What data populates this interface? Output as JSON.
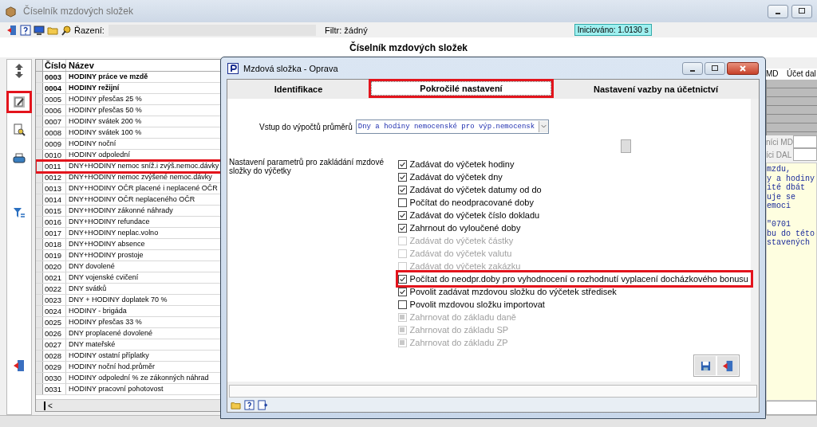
{
  "window": {
    "title": "Číselník mzdových složek"
  },
  "toolbar": {
    "sort_label": "Řazení:",
    "filter": "Filtr: žádný",
    "timer": "Iniciováno: 1.0130 s"
  },
  "heading": "Číselník mzdových složek",
  "side_tools": [
    {
      "kind": "up",
      "marked": false
    },
    {
      "kind": "down",
      "marked": false
    },
    {
      "kind": "edit",
      "marked": true
    },
    {
      "kind": "find",
      "marked": false
    },
    {
      "kind": "print",
      "marked": false
    },
    {
      "kind": "filter",
      "marked": false
    },
    {
      "kind": "exit",
      "marked": false
    }
  ],
  "table": {
    "columns": [
      "Číslo",
      "Název"
    ],
    "rows": [
      {
        "code": "0003",
        "name": "HODINY práce ve mzdě",
        "bold": true,
        "marked": false
      },
      {
        "code": "0004",
        "name": "HODINY režijní",
        "bold": true,
        "marked": false
      },
      {
        "code": "0005",
        "name": "HODINY přesčas 25 %",
        "bold": false,
        "marked": false
      },
      {
        "code": "0006",
        "name": "HODINY přesčas 50 %",
        "bold": false,
        "marked": false
      },
      {
        "code": "0007",
        "name": "HODINY svátek 200 %",
        "bold": false,
        "marked": false
      },
      {
        "code": "0008",
        "name": "HODINY svátek 100 %",
        "bold": false,
        "marked": false
      },
      {
        "code": "0009",
        "name": "HODINY noční",
        "bold": false,
        "marked": false
      },
      {
        "code": "0010",
        "name": "HODINY odpolední",
        "bold": false,
        "marked": false
      },
      {
        "code": "0011",
        "name": "DNY+HODINY nemoc sníž.i zvýš.nemoc.dávky",
        "bold": false,
        "marked": true
      },
      {
        "code": "0012",
        "name": "DNY+HODINY nemoc zvýšené nemoc.dávky",
        "bold": false,
        "marked": false
      },
      {
        "code": "0013",
        "name": "DNY+HODINY OČR placené i neplacené OČR",
        "bold": false,
        "marked": false
      },
      {
        "code": "0014",
        "name": "DNY+HODINY OČR neplaceného OČR",
        "bold": false,
        "marked": false
      },
      {
        "code": "0015",
        "name": "DNY+HODINY zákonné náhrady",
        "bold": false,
        "marked": false
      },
      {
        "code": "0016",
        "name": "DNY+HODINY refundace",
        "bold": false,
        "marked": false
      },
      {
        "code": "0017",
        "name": "DNY+HODINY neplac.volno",
        "bold": false,
        "marked": false
      },
      {
        "code": "0018",
        "name": "DNY+HODINY absence",
        "bold": false,
        "marked": false
      },
      {
        "code": "0019",
        "name": "DNY+HODINY prostoje",
        "bold": false,
        "marked": false
      },
      {
        "code": "0020",
        "name": "DNY dovolené",
        "bold": false,
        "marked": false
      },
      {
        "code": "0021",
        "name": "DNY vojenské cvičení",
        "bold": false,
        "marked": false
      },
      {
        "code": "0022",
        "name": "DNY svátků",
        "bold": false,
        "marked": false
      },
      {
        "code": "0023",
        "name": "DNY + HODINY doplatek 70 %",
        "bold": false,
        "marked": false
      },
      {
        "code": "0024",
        "name": "HODINY - brigáda",
        "bold": false,
        "marked": false
      },
      {
        "code": "0025",
        "name": "HODINY přesčas 33 %",
        "bold": false,
        "marked": false
      },
      {
        "code": "0026",
        "name": "DNY proplacené dovolené",
        "bold": false,
        "marked": false
      },
      {
        "code": "0027",
        "name": "DNY mateřské",
        "bold": false,
        "marked": false
      },
      {
        "code": "0028",
        "name": "HODINY ostatní příplatky",
        "bold": false,
        "marked": false
      },
      {
        "code": "0029",
        "name": "HODINY noční hod.průměr",
        "bold": false,
        "marked": false
      },
      {
        "code": "0030",
        "name": "HODINY odpolední % ze zákonných náhrad",
        "bold": false,
        "marked": false
      },
      {
        "code": "0031",
        "name": "HODINY pracovní pohotovost",
        "bold": false,
        "marked": false
      }
    ],
    "scroll_arrow": "<"
  },
  "side_panel": {
    "columns": [
      "MD",
      "Účet dal"
    ],
    "labels": [
      "níci MD",
      "íci DAL"
    ],
    "note_paragraphs": [
      [
        "mzdu,",
        "y a hodiny",
        "ité dbát",
        "uje se",
        "emoci"
      ],
      [
        "\"0701",
        "bu do této",
        "stavených"
      ]
    ]
  },
  "dialog": {
    "title": "Mzdová složka - Oprava",
    "tabs": [
      {
        "label": "Identifikace",
        "selected": false,
        "marked": false
      },
      {
        "label": "Pokročilé nastavení",
        "selected": true,
        "marked": true
      },
      {
        "label": "Nastavení vazby na účetnictví",
        "selected": false,
        "marked": false
      }
    ],
    "average_label": "Vstup do výpočtů průměrů",
    "average_value": "Dny a hodiny nemocenské pro výp.nemocensk",
    "params_label": "Nastavení parametrů pro zakládání mzdové složky do výčetky",
    "options": [
      {
        "label": "Zadávat do výčetek hodiny",
        "kind": "check",
        "checked": true,
        "disabled": false,
        "marked": false
      },
      {
        "label": "Zadávat do výčetek dny",
        "kind": "check",
        "checked": true,
        "disabled": false,
        "marked": false
      },
      {
        "label": "Zadávat do výčetek datumy od do",
        "kind": "check",
        "checked": true,
        "disabled": false,
        "marked": false
      },
      {
        "label": "Počítat do neodpracované doby",
        "kind": "check",
        "checked": false,
        "disabled": false,
        "marked": false
      },
      {
        "label": "Zadávat do výčetek číslo dokladu",
        "kind": "check",
        "checked": true,
        "disabled": false,
        "marked": false
      },
      {
        "label": "Zahrnout do vyloučené doby",
        "kind": "check",
        "checked": true,
        "disabled": false,
        "marked": false
      },
      {
        "label": "Zadávat do výčetek částky",
        "kind": "check",
        "checked": false,
        "disabled": true,
        "marked": false
      },
      {
        "label": "Zadávat do výčetek valutu",
        "kind": "check",
        "checked": false,
        "disabled": true,
        "marked": false
      },
      {
        "label": "Zadávat do výčetek zakázku",
        "kind": "check",
        "checked": false,
        "disabled": true,
        "marked": false
      },
      {
        "label": "Počítat do neodpr.doby pro vyhodnocení o rozhodnutí vyplacení docházkového bonusu",
        "kind": "check",
        "checked": true,
        "disabled": false,
        "marked": true
      },
      {
        "label": "Povolit zadávat mzdovou složku do výčetek středisek",
        "kind": "check",
        "checked": true,
        "disabled": false,
        "marked": false
      },
      {
        "label": "Povolit mzdovou složku importovat",
        "kind": "check",
        "checked": false,
        "disabled": false,
        "marked": false
      },
      {
        "label": "Zahrnovat do základu daně",
        "kind": "grayed",
        "checked": false,
        "disabled": true,
        "marked": false
      },
      {
        "label": "Zahrnovat do základu SP",
        "kind": "grayed",
        "checked": false,
        "disabled": true,
        "marked": false
      },
      {
        "label": "Zahrnovat do základu ZP",
        "kind": "grayed",
        "checked": false,
        "disabled": true,
        "marked": false
      }
    ]
  }
}
